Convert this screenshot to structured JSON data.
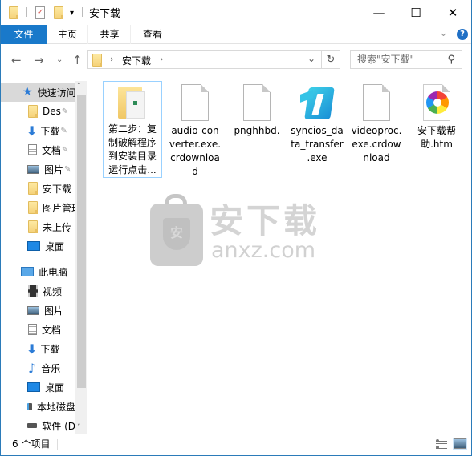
{
  "window": {
    "title": "安下载",
    "controls": {
      "minimize": "—",
      "maximize": "☐",
      "close": "✕"
    }
  },
  "quick_access_toolbar": {
    "customize": "▾"
  },
  "ribbon": {
    "tabs": [
      {
        "label": "文件",
        "active": true
      },
      {
        "label": "主页"
      },
      {
        "label": "共享"
      },
      {
        "label": "查看"
      }
    ],
    "expand": "⌄",
    "help": "?"
  },
  "nav": {
    "back": "←",
    "forward": "→",
    "recent": "⌄",
    "up": "↑",
    "breadcrumb": [
      "安下载"
    ],
    "separator": "›",
    "dropdown": "⌄",
    "refresh": "↻",
    "search_placeholder": "搜索\"安下载\"",
    "search_icon": "⚲"
  },
  "sidebar": {
    "quick_access": {
      "label": "快速访问",
      "icon": "star-icon"
    },
    "items": [
      {
        "label": "Des",
        "icon": "folder-icon",
        "pinned": true
      },
      {
        "label": "下载",
        "icon": "download-icon",
        "pinned": true
      },
      {
        "label": "文档",
        "icon": "document-icon",
        "pinned": true
      },
      {
        "label": "图片",
        "icon": "picture-icon",
        "pinned": true
      },
      {
        "label": "安下载",
        "icon": "folder-icon"
      },
      {
        "label": "图片管理",
        "icon": "folder-icon"
      },
      {
        "label": "未上传",
        "icon": "folder-icon"
      },
      {
        "label": "桌面",
        "icon": "desktop-icon"
      }
    ],
    "this_pc": {
      "label": "此电脑",
      "icon": "computer-icon"
    },
    "pc_items": [
      {
        "label": "视频",
        "icon": "video-icon"
      },
      {
        "label": "图片",
        "icon": "picture-icon"
      },
      {
        "label": "文档",
        "icon": "document-icon"
      },
      {
        "label": "下载",
        "icon": "download-icon"
      },
      {
        "label": "音乐",
        "icon": "music-icon"
      },
      {
        "label": "桌面",
        "icon": "desktop-icon"
      },
      {
        "label": "本地磁盘",
        "icon": "system-drive-icon"
      },
      {
        "label": "软件 (D",
        "icon": "drive-icon"
      }
    ],
    "pin_glyph": "📌"
  },
  "files": [
    {
      "name": "第二步：复制破解程序到安装目录运行点击...",
      "lines": [
        "第二步：复",
        "制破解程序",
        "到安装目录",
        "运行点击..."
      ],
      "type": "folder",
      "selected": true
    },
    {
      "name": "audio-converter.exe.crdownload",
      "lines": [
        "audio-con",
        "verter.exe.",
        "crdownloa",
        "d"
      ],
      "type": "blank"
    },
    {
      "name": "pnghhbd.",
      "lines": [
        "pnghhbd."
      ],
      "type": "blank"
    },
    {
      "name": "syncios_data_transfer.exe",
      "lines": [
        "syncios_da",
        "ta_transfer",
        ".exe"
      ],
      "type": "syncios"
    },
    {
      "name": "videoproc.exe.crdownload",
      "lines": [
        "videoproc.",
        "exe.crdow",
        "nload"
      ],
      "type": "blank"
    },
    {
      "name": "安下载帮助.htm",
      "lines": [
        "安下载帮",
        "助.htm"
      ],
      "type": "htm"
    }
  ],
  "watermark": {
    "text_cn": "安下载",
    "text_en": "anxz.com",
    "badge": "安"
  },
  "status": {
    "count": "6 个项目"
  },
  "colors": {
    "accent": "#1979ca",
    "selection_border": "#99d1ff",
    "sidebar_selected": "#d9d9d9"
  }
}
